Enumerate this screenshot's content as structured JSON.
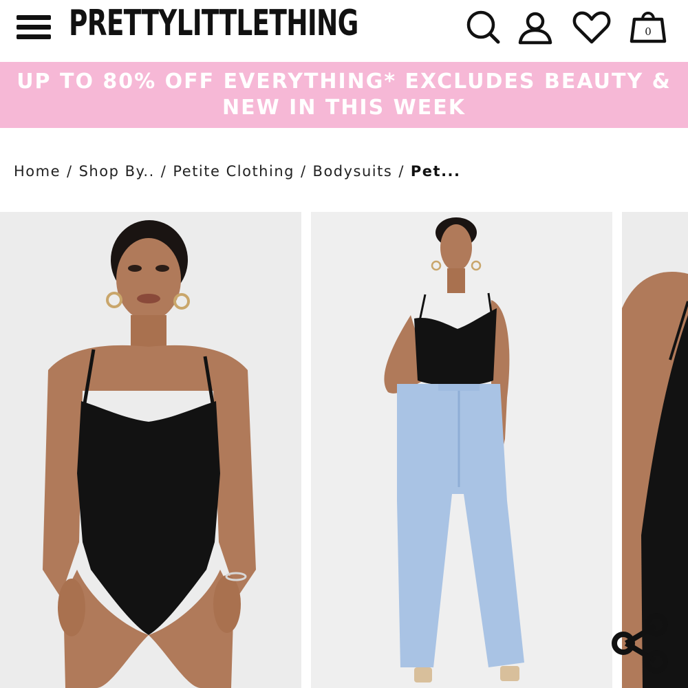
{
  "header": {
    "brand": "PRETTYLITTLETHING",
    "bag_count": "0",
    "icons": [
      "menu-icon",
      "search-icon",
      "account-icon",
      "heart-icon",
      "shopping-bag-icon"
    ]
  },
  "promo": {
    "text": "UP TO 80% OFF EVERYTHING* EXCLUDES BEAUTY & NEW IN THIS WEEK",
    "background": "#f6b8d6",
    "text_color": "#ffffff"
  },
  "breadcrumb": {
    "items": [
      "Home",
      "Shop By..",
      "Petite Clothing",
      "Bodysuits"
    ],
    "separator": "/",
    "current": "Pet..."
  },
  "gallery": {
    "images": [
      "product-photo-front-closeup",
      "product-photo-full-length",
      "product-photo-side-detail"
    ]
  },
  "share": {
    "icon": "share-icon"
  },
  "colors": {
    "text": "#111111",
    "accent_pink": "#f6b8d6",
    "photo_bg": "#ececec"
  }
}
